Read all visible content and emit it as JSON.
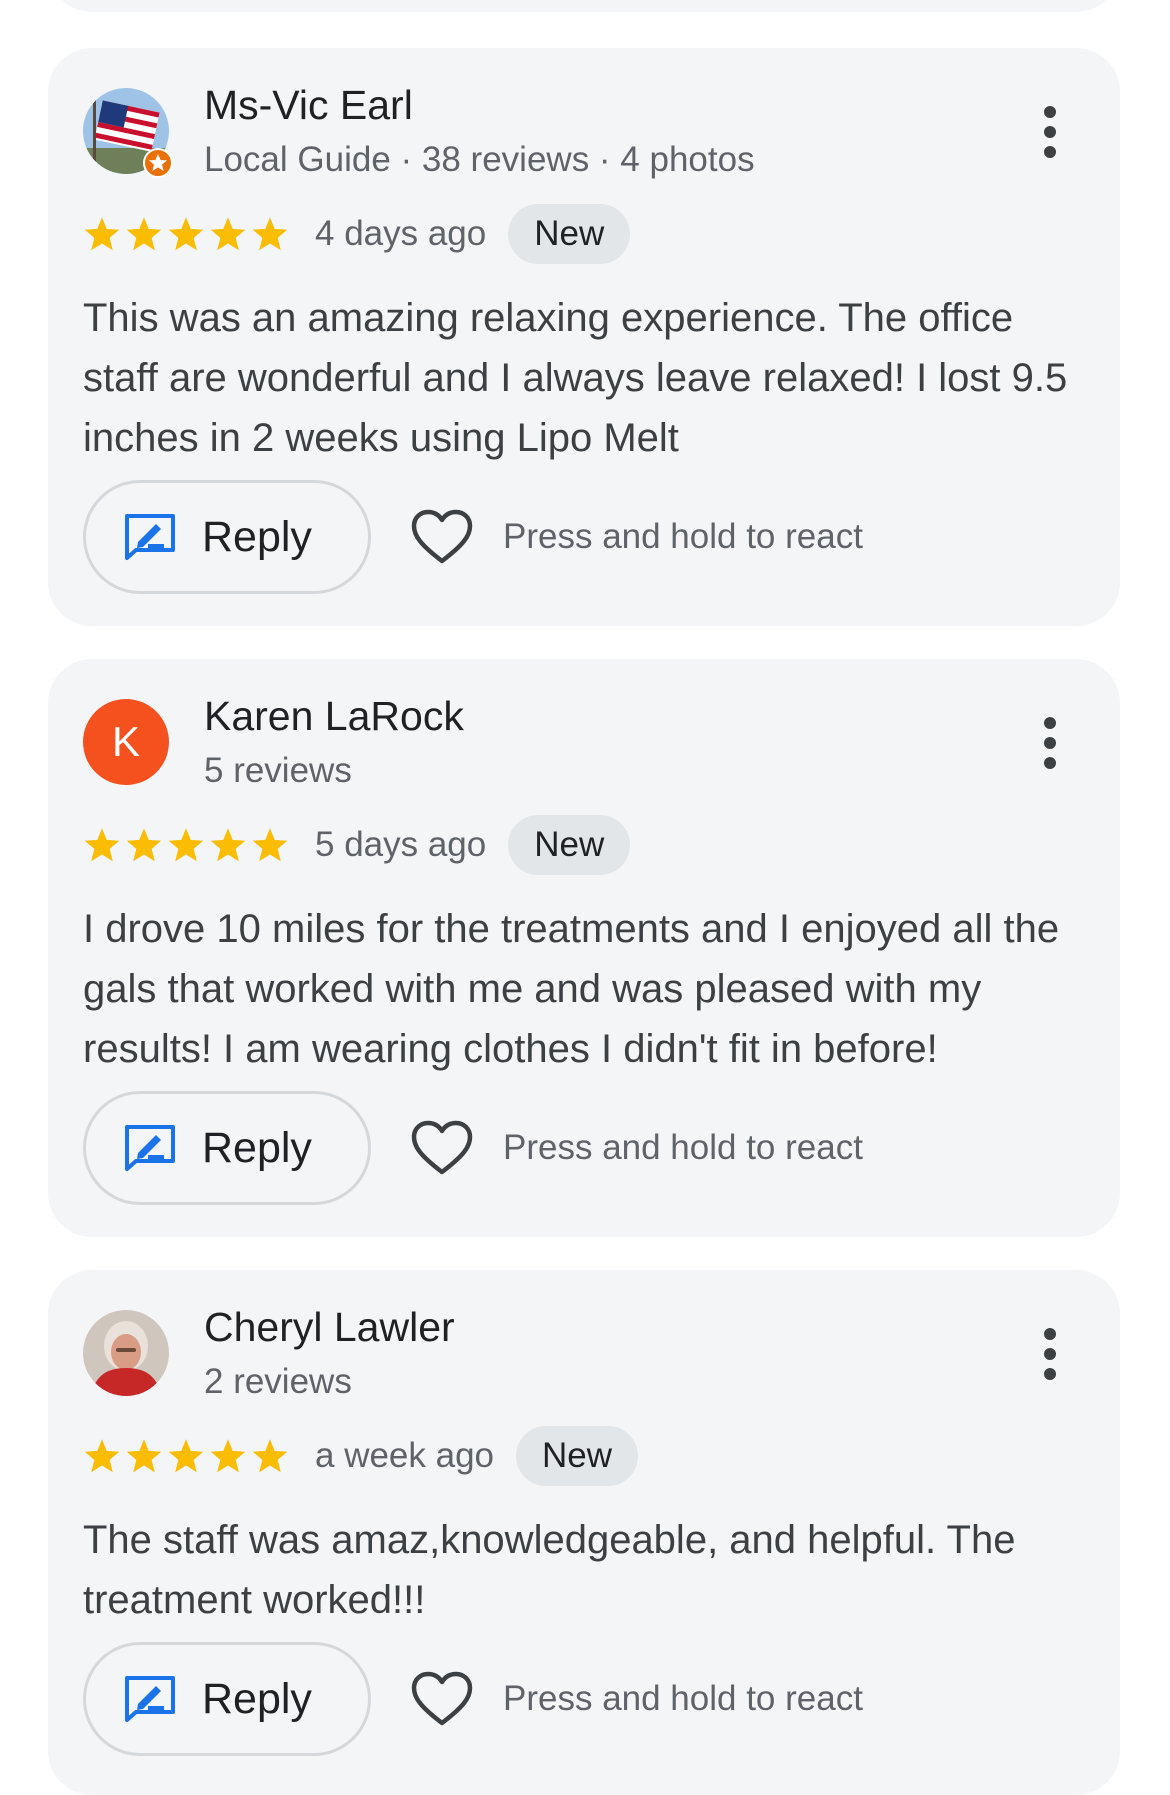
{
  "reviews": [
    {
      "name": "Ms-Vic Earl",
      "meta": "Local Guide · 38 reviews · 4 photos",
      "avatar": "flag-photo",
      "rating": 5,
      "date": "4 days ago",
      "badge": "New",
      "text": "This was an amazing relaxing experience. The office staff are wonderful and I always leave relaxed! I lost 9.5 inches in 2 weeks using Lipo Melt",
      "reply_label": "Reply",
      "react_label": "Press and hold to react"
    },
    {
      "name": "Karen LaRock",
      "meta": "5 reviews",
      "avatar_letter": "K",
      "rating": 5,
      "date": "5 days ago",
      "badge": "New",
      "text": "I drove 10 miles for the treatments and I enjoyed all the gals that worked with me and was pleased with my results! I am wearing clothes I didn't fit in before!",
      "reply_label": "Reply",
      "react_label": "Press and hold to react"
    },
    {
      "name": "Cheryl Lawler",
      "meta": "2 reviews",
      "avatar": "person-photo",
      "rating": 5,
      "date": "a week ago",
      "badge": "New",
      "text": "The staff was amaz,knowledgeable, and helpful. The treatment worked!!!",
      "reply_label": "Reply",
      "react_label": "Press and hold to react"
    }
  ],
  "colors": {
    "card_background": "#f3f5f7",
    "star": "#fbbc04",
    "reply_icon": "#1a73e8",
    "avatar_letter_bg": "#f4511e",
    "local_guide_badge": "#e8710a"
  },
  "icons": {
    "more": "more-vert-icon",
    "reply": "reply-edit-icon",
    "react": "heart-outline-icon",
    "star": "star-icon"
  }
}
